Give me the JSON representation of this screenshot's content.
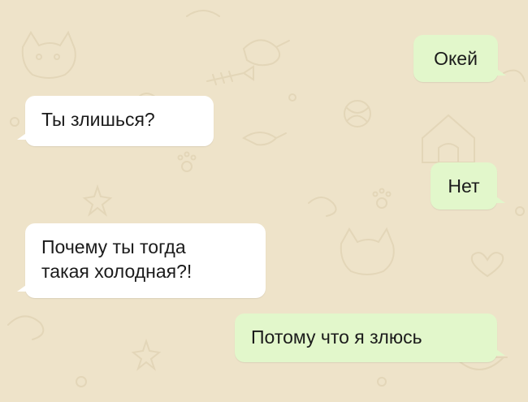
{
  "chat": {
    "messages": [
      {
        "direction": "outgoing",
        "text": "Окей"
      },
      {
        "direction": "incoming",
        "text": "Ты злишься?"
      },
      {
        "direction": "outgoing",
        "text": "Нет"
      },
      {
        "direction": "incoming",
        "lines": [
          "Почему ты тогда",
          "такая холодная?!"
        ]
      },
      {
        "direction": "outgoing",
        "text": "Потому что я злюсь"
      }
    ]
  },
  "colors": {
    "wallpaper": "#eee3c9",
    "doodle": "#e3d6b8",
    "outgoing_bubble": "#e2f7cb",
    "incoming_bubble": "#ffffff",
    "text": "#1b1b1b"
  }
}
